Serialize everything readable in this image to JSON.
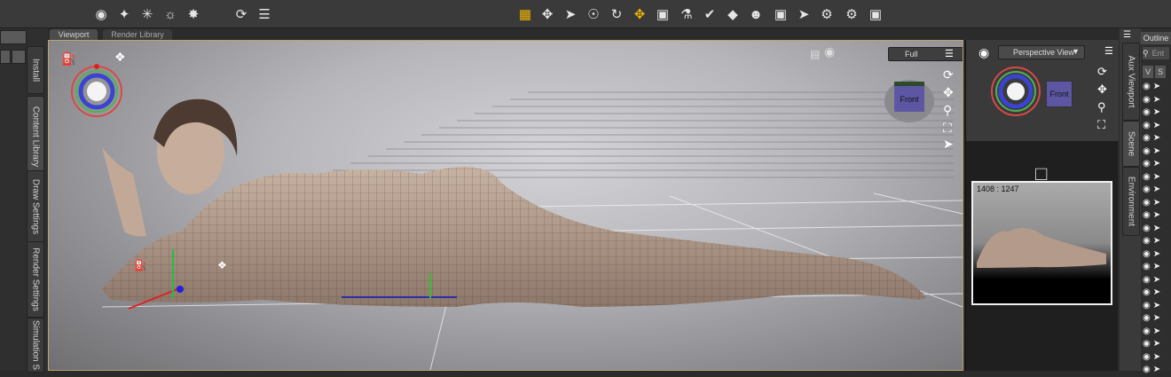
{
  "toolbar": {
    "left_icons": [
      "add-camera-icon",
      "light-wand-icon",
      "spot-light-icon",
      "distant-light-icon",
      "point-light-icon",
      "reset-icon",
      "list-icon"
    ],
    "center_icons": [
      "grid-icon",
      "universal-tool-icon",
      "pointer-icon",
      "node-selection-icon",
      "rotate-icon",
      "translate-icon",
      "scale-icon",
      "joint-editor-icon",
      "geometry-editor-icon",
      "surface-selection-icon",
      "figure-icon",
      "render-icon",
      "spot-render-icon",
      "iray-render-icon",
      "render-settings-icon",
      "camera-render-icon"
    ]
  },
  "tabs": {
    "viewport": "Viewport",
    "render_library": "Render Library"
  },
  "left_dock": {
    "tabs": [
      "Install",
      "Content Library",
      "Draw Settings",
      "Render Settings",
      "Simulation S"
    ]
  },
  "viewport": {
    "camera_select": "Full",
    "view_cube_label": "Front"
  },
  "aux_viewport": {
    "view_select": "Perspective View",
    "view_cube_label": "Front",
    "resolution": "1408 : 1247"
  },
  "right_dock": {
    "tabs": [
      "Aux Viewport",
      "Scene",
      "Environment"
    ],
    "outline_label": "Outline",
    "search_placeholder": "Ent",
    "col_v": "V",
    "col_s": "S"
  },
  "colors": {
    "accent_frame": "#b9a46a",
    "selection_gold": "#f0b400",
    "cube_face": "#5d57a3"
  }
}
